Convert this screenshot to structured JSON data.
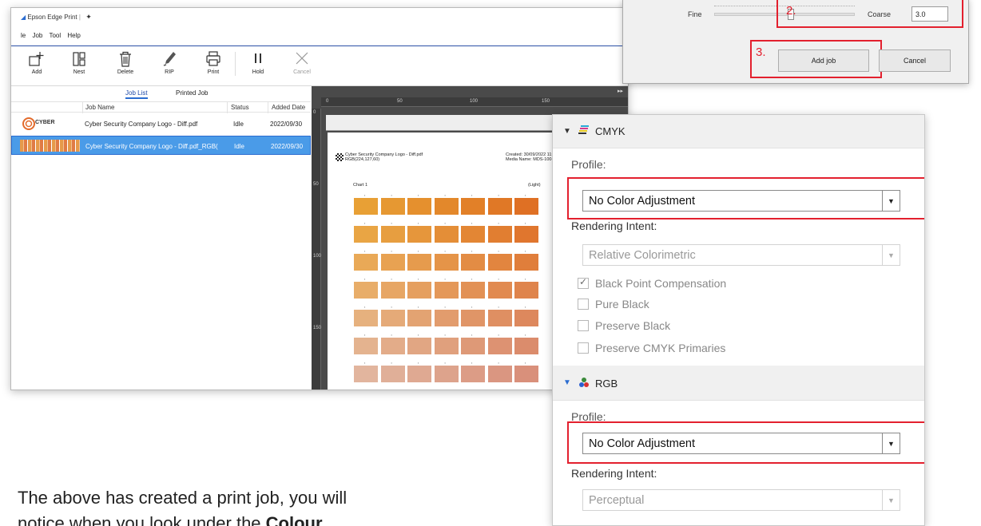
{
  "main_window": {
    "title": "Epson Edge Print",
    "menu": [
      "le",
      "Job",
      "Tool",
      "Help"
    ],
    "toolbar": {
      "add": "Add",
      "nest": "Nest",
      "delete": "Delete",
      "rip": "RIP",
      "print": "Print",
      "hold": "Hold",
      "cancel": "Cancel"
    },
    "tabs": [
      "Job List",
      "Printed Job"
    ],
    "columns": [
      "Job Name",
      "Status",
      "Added Date"
    ],
    "jobs": [
      {
        "name": "Cyber Security Company Logo - Diff.pdf",
        "status": "Idle",
        "date": "2022/09/30",
        "thumb": "CYBER"
      },
      {
        "name": "Cyber Security Company Logo - Diff.pdf_RGB(",
        "status": "Idle",
        "date": "2022/09/30"
      }
    ],
    "preview": {
      "ruler_top": [
        "0",
        "50",
        "100",
        "150"
      ],
      "ruler_left": [
        "0",
        "50",
        "100",
        "150"
      ],
      "doc_title": "Cyber Security Company Logo - Diff.pdf",
      "doc_sub": "RGB(224,127,60)",
      "created": "Created: 30/09/2022 11:51:29 A",
      "media": "Media Name: MDS-100-137 (W",
      "chart_label": "Chart 1",
      "chart_tag": "(Light)",
      "swatch_colors": [
        [
          "#e8a035",
          "#e69832",
          "#e5902e",
          "#e3882b",
          "#e28028",
          "#e07826",
          "#df7024"
        ],
        [
          "#e9a544",
          "#e79e40",
          "#e6963b",
          "#e48e37",
          "#e38634",
          "#e17e31",
          "#e0762e"
        ],
        [
          "#e9a957",
          "#e8a252",
          "#e69b4d",
          "#e59448",
          "#e38c44",
          "#e2853f",
          "#e07e3b"
        ],
        [
          "#e8ad69",
          "#e7a664",
          "#e59f5f",
          "#e49859",
          "#e29155",
          "#e18a50",
          "#df844c"
        ],
        [
          "#e6b17e",
          "#e5aa78",
          "#e3a372",
          "#e29c6d",
          "#e09567",
          "#df8f62",
          "#dd885d"
        ],
        [
          "#e4b38f",
          "#e3ac89",
          "#e1a683",
          "#e0a07d",
          "#de9977",
          "#dd9272",
          "#db8c6c"
        ],
        [
          "#e2b59e",
          "#e0af98",
          "#dfa992",
          "#dda38c",
          "#dc9c86",
          "#da9681",
          "#d9907b"
        ]
      ]
    }
  },
  "dialog": {
    "fine_label": "Fine",
    "coarse_label": "Coarse",
    "value": "3.0",
    "step2": "2.",
    "step3": "3.",
    "add_job": "Add job",
    "cancel": "Cancel"
  },
  "colour_panel": {
    "cmyk": {
      "title": "CMYK",
      "profile_label": "Profile:",
      "profile_value": "No Color Adjustment",
      "intent_label": "Rendering Intent:",
      "intent_value": "Relative Colorimetric",
      "options": [
        {
          "label": "Black Point Compensation",
          "checked": true
        },
        {
          "label": "Pure Black",
          "checked": false
        },
        {
          "label": "Preserve Black",
          "checked": false
        },
        {
          "label": "Preserve CMYK Primaries",
          "checked": false
        }
      ]
    },
    "rgb": {
      "title": "RGB",
      "profile_label": "Profile:",
      "profile_value": "No Color Adjustment",
      "intent_label": "Rendering Intent:",
      "intent_value": "Perceptual"
    }
  },
  "body_text": {
    "line1": "The above has created a print job, you will",
    "line2_pre": "notice when you look under the ",
    "line2_bold": "Colour"
  }
}
